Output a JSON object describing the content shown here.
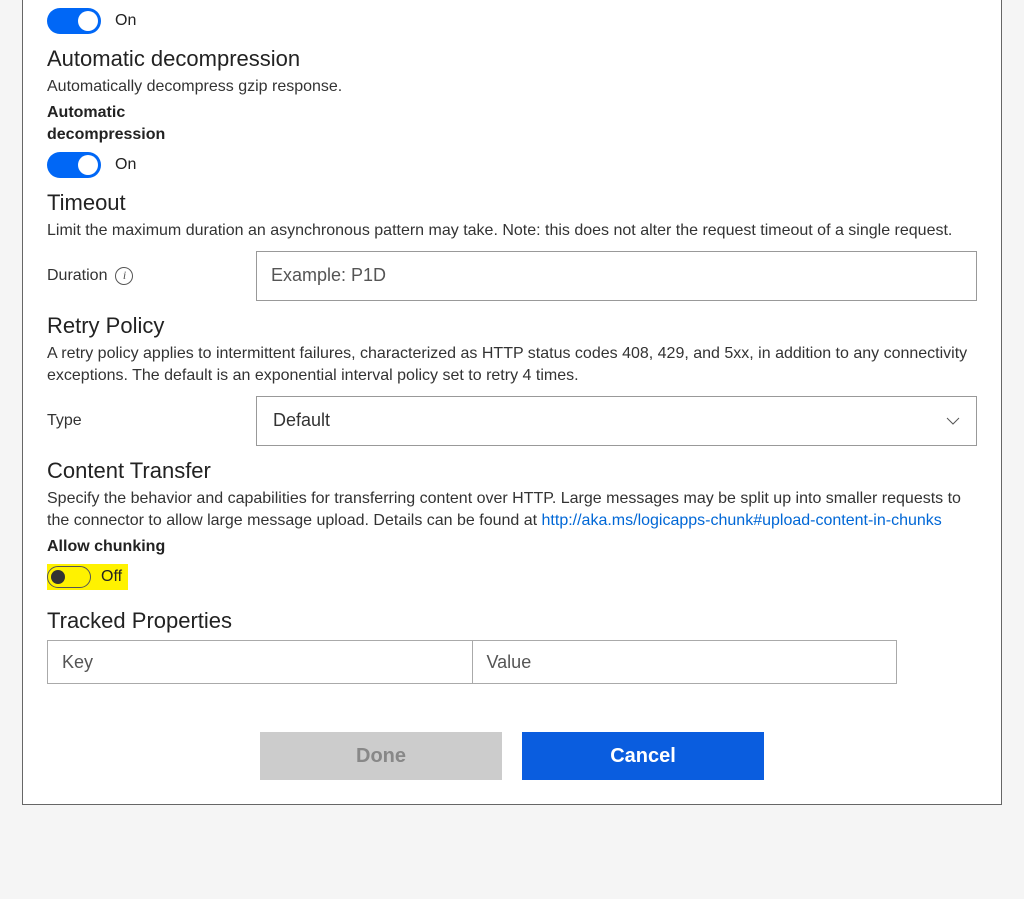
{
  "toggle1": {
    "state": "On"
  },
  "autoDecompression": {
    "title": "Automatic decompression",
    "desc": "Automatically decompress gzip response.",
    "subline1": "Automatic",
    "subline2": "decompression",
    "state": "On"
  },
  "timeout": {
    "title": "Timeout",
    "desc": "Limit the maximum duration an asynchronous pattern may take. Note: this does not alter the request timeout of a single request.",
    "durationLabel": "Duration",
    "placeholder": "Example: P1D",
    "value": ""
  },
  "retry": {
    "title": "Retry Policy",
    "desc": "A retry policy applies to intermittent failures, characterized as HTTP status codes 408, 429, and 5xx, in addition to any connectivity exceptions. The default is an exponential interval policy set to retry 4 times.",
    "typeLabel": "Type",
    "value": "Default"
  },
  "contentTransfer": {
    "title": "Content Transfer",
    "desc": "Specify the behavior and capabilities for transferring content over HTTP. Large messages may be split up into smaller requests to the connector to allow large message upload. Details can be found at ",
    "link": "http://aka.ms/logicapps-chunk#upload-content-in-chunks",
    "allowChunking": "Allow chunking",
    "state": "Off"
  },
  "tracked": {
    "title": "Tracked Properties",
    "keyHeader": "Key",
    "valueHeader": "Value"
  },
  "buttons": {
    "done": "Done",
    "cancel": "Cancel"
  }
}
